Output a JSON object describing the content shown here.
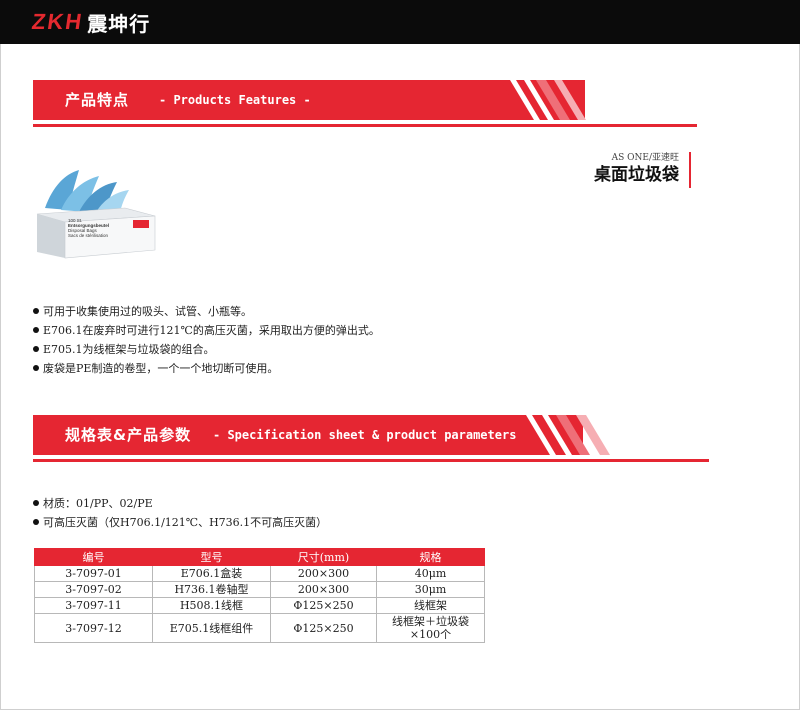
{
  "header": {
    "logo_latin": "ZKH",
    "logo_cn": "震坤行"
  },
  "features_banner": {
    "title": "产品特点",
    "subtitle": "-  Products Features -"
  },
  "product": {
    "brand": "AS ONE/亚速旺",
    "name": "桌面垃圾袋",
    "box_text": [
      "100 St.",
      "Entsorgungsbeutel",
      "Disposal Bags",
      "Sacs de stérilisation"
    ]
  },
  "features": [
    "可用于收集使用过的吸头、试管、小瓶等。",
    "E706.1在废弃时可进行121℃的高压灭菌，采用取出方便的弹出式。",
    "E705.1为线框架与垃圾袋的组合。",
    "废袋是PE制造的卷型，一个一个地切断可使用。"
  ],
  "spec_banner": {
    "title": "规格表&产品参数",
    "subtitle": "-   Specification sheet & product parameters"
  },
  "spec_notes": [
    "材质：01/PP、02/PE",
    "可高压灭菌（仅H706.1/121℃、H736.1不可高压灭菌）"
  ],
  "table": {
    "headers": [
      "编号",
      "型号",
      "尺寸(mm)",
      "规格"
    ],
    "rows": [
      [
        "3-7097-01",
        "E706.1盒装",
        "200×300",
        "40μm"
      ],
      [
        "3-7097-02",
        "H736.1卷轴型",
        "200×300",
        "30μm"
      ],
      [
        "3-7097-11",
        "H508.1线框",
        "Φ125×250",
        "线框架"
      ],
      [
        "3-7097-12",
        "E705.1线框组件",
        "Φ125×250",
        "线框架＋垃圾袋×100个"
      ]
    ]
  },
  "colors": {
    "accent": "#e52632",
    "topbar": "#0b0b0b"
  }
}
